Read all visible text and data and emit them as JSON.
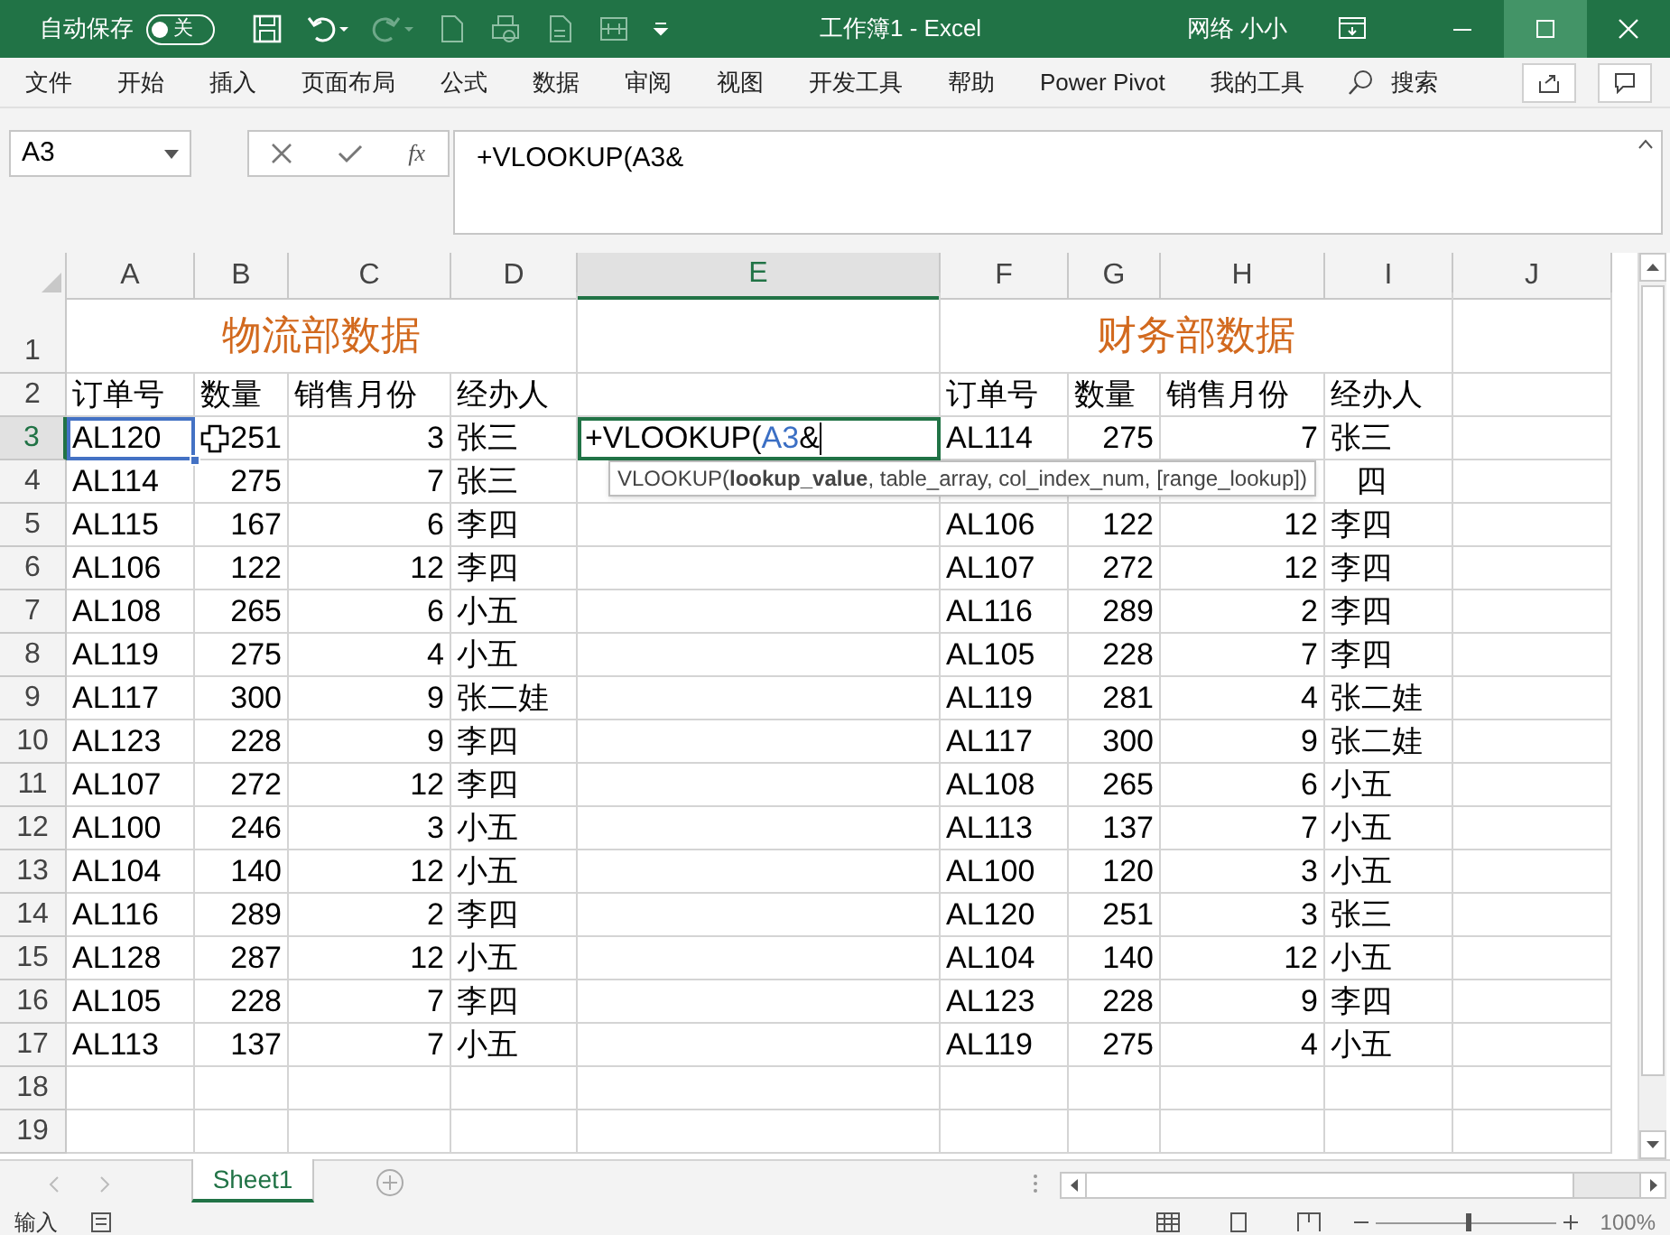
{
  "title_bar": {
    "autosave_label": "自动保存",
    "autosave": {
      "on": false,
      "label": "关"
    },
    "title": "工作簿1 - Excel",
    "user": "网络 小小"
  },
  "ribbon_tabs": [
    {
      "label": "文件"
    },
    {
      "label": "开始"
    },
    {
      "label": "插入"
    },
    {
      "label": "页面布局"
    },
    {
      "label": "公式"
    },
    {
      "label": "数据"
    },
    {
      "label": "审阅"
    },
    {
      "label": "视图"
    },
    {
      "label": "开发工具"
    },
    {
      "label": "帮助"
    },
    {
      "label": "Power Pivot"
    },
    {
      "label": "我的工具"
    }
  ],
  "search_label": "搜索",
  "name_box": "A3",
  "fx_label": "fx",
  "formula": "+VLOOKUP(A3&",
  "columns": [
    {
      "label": "A",
      "selected": false
    },
    {
      "label": "B",
      "selected": false
    },
    {
      "label": "C",
      "selected": false
    },
    {
      "label": "D",
      "selected": false
    },
    {
      "label": "E",
      "selected": true
    },
    {
      "label": "F",
      "selected": false
    },
    {
      "label": "G",
      "selected": false
    },
    {
      "label": "H",
      "selected": false
    },
    {
      "label": "I",
      "selected": false
    },
    {
      "label": "J",
      "selected": false
    }
  ],
  "rows": [
    {
      "label": "1",
      "selected": false,
      "kind": "title",
      "cells": {
        "A": {
          "text": "物流部数据"
        },
        "F": {
          "text": "财务部数据"
        }
      }
    },
    {
      "label": "2",
      "selected": false,
      "kind": "data",
      "cells": {
        "A": {
          "text": "订单号"
        },
        "B": {
          "text": "数量"
        },
        "C": {
          "text": "销售月份"
        },
        "D": {
          "text": "经办人"
        },
        "F": {
          "text": "订单号"
        },
        "G": {
          "text": "数量"
        },
        "H": {
          "text": "销售月份"
        },
        "I": {
          "text": "经办人"
        }
      }
    },
    {
      "label": "3",
      "selected": true,
      "kind": "data",
      "cells": {
        "A": {
          "text": "AL120",
          "kind": "reference"
        },
        "B": {
          "text": "251",
          "kind": "number"
        },
        "C": {
          "text": "3",
          "kind": "number"
        },
        "D": {
          "text": "张三"
        },
        "E": {
          "kind": "editor",
          "parts": [
            {
              "text": "+VLOOKUP(",
              "ref": false
            },
            {
              "text": "A3",
              "ref": true
            },
            {
              "text": "&",
              "ref": false
            }
          ]
        },
        "F": {
          "text": "AL114"
        },
        "G": {
          "text": "275",
          "kind": "number"
        },
        "H": {
          "text": "7",
          "kind": "number"
        },
        "I": {
          "text": "张三"
        }
      }
    },
    {
      "label": "4",
      "selected": false,
      "kind": "data",
      "cells": {
        "A": {
          "text": "AL114"
        },
        "B": {
          "text": "275",
          "kind": "number"
        },
        "C": {
          "text": "7",
          "kind": "number"
        },
        "D": {
          "text": "张三"
        },
        "I": {
          "text": "四",
          "kind": "partial"
        }
      }
    },
    {
      "label": "5",
      "selected": false,
      "kind": "data",
      "cells": {
        "A": {
          "text": "AL115"
        },
        "B": {
          "text": "167",
          "kind": "number"
        },
        "C": {
          "text": "6",
          "kind": "number"
        },
        "D": {
          "text": "李四"
        },
        "F": {
          "text": "AL106"
        },
        "G": {
          "text": "122",
          "kind": "number"
        },
        "H": {
          "text": "12",
          "kind": "number"
        },
        "I": {
          "text": "李四"
        }
      }
    },
    {
      "label": "6",
      "selected": false,
      "kind": "data",
      "cells": {
        "A": {
          "text": "AL106"
        },
        "B": {
          "text": "122",
          "kind": "number"
        },
        "C": {
          "text": "12",
          "kind": "number"
        },
        "D": {
          "text": "李四"
        },
        "F": {
          "text": "AL107"
        },
        "G": {
          "text": "272",
          "kind": "number"
        },
        "H": {
          "text": "12",
          "kind": "number"
        },
        "I": {
          "text": "李四"
        }
      }
    },
    {
      "label": "7",
      "selected": false,
      "kind": "data",
      "cells": {
        "A": {
          "text": "AL108"
        },
        "B": {
          "text": "265",
          "kind": "number"
        },
        "C": {
          "text": "6",
          "kind": "number"
        },
        "D": {
          "text": "小五"
        },
        "F": {
          "text": "AL116"
        },
        "G": {
          "text": "289",
          "kind": "number"
        },
        "H": {
          "text": "2",
          "kind": "number"
        },
        "I": {
          "text": "李四"
        }
      }
    },
    {
      "label": "8",
      "selected": false,
      "kind": "data",
      "cells": {
        "A": {
          "text": "AL119"
        },
        "B": {
          "text": "275",
          "kind": "number"
        },
        "C": {
          "text": "4",
          "kind": "number"
        },
        "D": {
          "text": "小五"
        },
        "F": {
          "text": "AL105"
        },
        "G": {
          "text": "228",
          "kind": "number"
        },
        "H": {
          "text": "7",
          "kind": "number"
        },
        "I": {
          "text": "李四"
        }
      }
    },
    {
      "label": "9",
      "selected": false,
      "kind": "data",
      "cells": {
        "A": {
          "text": "AL117"
        },
        "B": {
          "text": "300",
          "kind": "number"
        },
        "C": {
          "text": "9",
          "kind": "number"
        },
        "D": {
          "text": "张二娃"
        },
        "F": {
          "text": "AL119"
        },
        "G": {
          "text": "281",
          "kind": "number"
        },
        "H": {
          "text": "4",
          "kind": "number"
        },
        "I": {
          "text": "张二娃"
        }
      }
    },
    {
      "label": "10",
      "selected": false,
      "kind": "data",
      "cells": {
        "A": {
          "text": "AL123"
        },
        "B": {
          "text": "228",
          "kind": "number"
        },
        "C": {
          "text": "9",
          "kind": "number"
        },
        "D": {
          "text": "李四"
        },
        "F": {
          "text": "AL117"
        },
        "G": {
          "text": "300",
          "kind": "number"
        },
        "H": {
          "text": "9",
          "kind": "number"
        },
        "I": {
          "text": "张二娃"
        }
      }
    },
    {
      "label": "11",
      "selected": false,
      "kind": "data",
      "cells": {
        "A": {
          "text": "AL107"
        },
        "B": {
          "text": "272",
          "kind": "number"
        },
        "C": {
          "text": "12",
          "kind": "number"
        },
        "D": {
          "text": "李四"
        },
        "F": {
          "text": "AL108"
        },
        "G": {
          "text": "265",
          "kind": "number"
        },
        "H": {
          "text": "6",
          "kind": "number"
        },
        "I": {
          "text": "小五"
        }
      }
    },
    {
      "label": "12",
      "selected": false,
      "kind": "data",
      "cells": {
        "A": {
          "text": "AL100"
        },
        "B": {
          "text": "246",
          "kind": "number"
        },
        "C": {
          "text": "3",
          "kind": "number"
        },
        "D": {
          "text": "小五"
        },
        "F": {
          "text": "AL113"
        },
        "G": {
          "text": "137",
          "kind": "number"
        },
        "H": {
          "text": "7",
          "kind": "number"
        },
        "I": {
          "text": "小五"
        }
      }
    },
    {
      "label": "13",
      "selected": false,
      "kind": "data",
      "cells": {
        "A": {
          "text": "AL104"
        },
        "B": {
          "text": "140",
          "kind": "number"
        },
        "C": {
          "text": "12",
          "kind": "number"
        },
        "D": {
          "text": "小五"
        },
        "F": {
          "text": "AL100"
        },
        "G": {
          "text": "120",
          "kind": "number"
        },
        "H": {
          "text": "3",
          "kind": "number"
        },
        "I": {
          "text": "小五"
        }
      }
    },
    {
      "label": "14",
      "selected": false,
      "kind": "data",
      "cells": {
        "A": {
          "text": "AL116"
        },
        "B": {
          "text": "289",
          "kind": "number"
        },
        "C": {
          "text": "2",
          "kind": "number"
        },
        "D": {
          "text": "李四"
        },
        "F": {
          "text": "AL120"
        },
        "G": {
          "text": "251",
          "kind": "number"
        },
        "H": {
          "text": "3",
          "kind": "number"
        },
        "I": {
          "text": "张三"
        }
      }
    },
    {
      "label": "15",
      "selected": false,
      "kind": "data",
      "cells": {
        "A": {
          "text": "AL128"
        },
        "B": {
          "text": "287",
          "kind": "number"
        },
        "C": {
          "text": "12",
          "kind": "number"
        },
        "D": {
          "text": "小五"
        },
        "F": {
          "text": "AL104"
        },
        "G": {
          "text": "140",
          "kind": "number"
        },
        "H": {
          "text": "12",
          "kind": "number"
        },
        "I": {
          "text": "小五"
        }
      }
    },
    {
      "label": "16",
      "selected": false,
      "kind": "data",
      "cells": {
        "A": {
          "text": "AL105"
        },
        "B": {
          "text": "228",
          "kind": "number"
        },
        "C": {
          "text": "7",
          "kind": "number"
        },
        "D": {
          "text": "李四"
        },
        "F": {
          "text": "AL123"
        },
        "G": {
          "text": "228",
          "kind": "number"
        },
        "H": {
          "text": "9",
          "kind": "number"
        },
        "I": {
          "text": "李四"
        }
      }
    },
    {
      "label": "17",
      "selected": false,
      "kind": "data",
      "cells": {
        "A": {
          "text": "AL113"
        },
        "B": {
          "text": "137",
          "kind": "number"
        },
        "C": {
          "text": "7",
          "kind": "number"
        },
        "D": {
          "text": "小五"
        },
        "F": {
          "text": "AL119"
        },
        "G": {
          "text": "275",
          "kind": "number"
        },
        "H": {
          "text": "4",
          "kind": "number"
        },
        "I": {
          "text": "小五"
        }
      }
    },
    {
      "label": "18",
      "selected": false,
      "kind": "data"
    },
    {
      "label": "19",
      "selected": false,
      "kind": "data"
    }
  ],
  "tooltip": "VLOOKUP(**lookup_value**, table_array, col_index_num, [range_lookup])",
  "sheet_tabs": [
    {
      "label": "Sheet1",
      "selected": true
    }
  ],
  "status_bar": {
    "mode": "输入",
    "zoom": "100%",
    "zoom_slider": {
      "level": 0.5
    }
  }
}
